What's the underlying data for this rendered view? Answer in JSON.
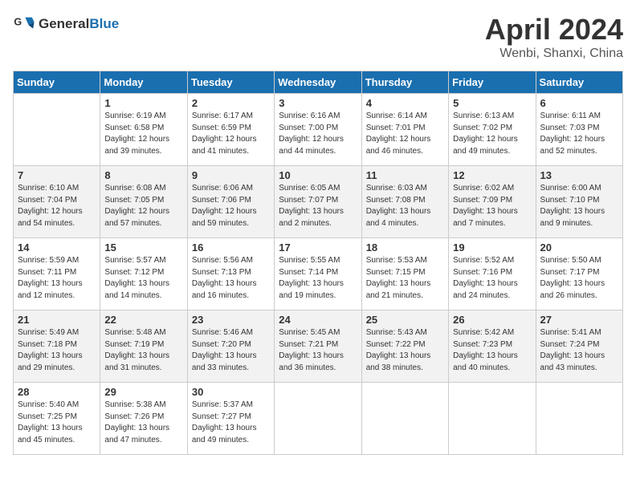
{
  "header": {
    "logo_general": "General",
    "logo_blue": "Blue",
    "month_year": "April 2024",
    "location": "Wenbi, Shanxi, China"
  },
  "days_of_week": [
    "Sunday",
    "Monday",
    "Tuesday",
    "Wednesday",
    "Thursday",
    "Friday",
    "Saturday"
  ],
  "weeks": [
    [
      {
        "day": "",
        "info": ""
      },
      {
        "day": "1",
        "info": "Sunrise: 6:19 AM\nSunset: 6:58 PM\nDaylight: 12 hours\nand 39 minutes."
      },
      {
        "day": "2",
        "info": "Sunrise: 6:17 AM\nSunset: 6:59 PM\nDaylight: 12 hours\nand 41 minutes."
      },
      {
        "day": "3",
        "info": "Sunrise: 6:16 AM\nSunset: 7:00 PM\nDaylight: 12 hours\nand 44 minutes."
      },
      {
        "day": "4",
        "info": "Sunrise: 6:14 AM\nSunset: 7:01 PM\nDaylight: 12 hours\nand 46 minutes."
      },
      {
        "day": "5",
        "info": "Sunrise: 6:13 AM\nSunset: 7:02 PM\nDaylight: 12 hours\nand 49 minutes."
      },
      {
        "day": "6",
        "info": "Sunrise: 6:11 AM\nSunset: 7:03 PM\nDaylight: 12 hours\nand 52 minutes."
      }
    ],
    [
      {
        "day": "7",
        "info": "Sunrise: 6:10 AM\nSunset: 7:04 PM\nDaylight: 12 hours\nand 54 minutes."
      },
      {
        "day": "8",
        "info": "Sunrise: 6:08 AM\nSunset: 7:05 PM\nDaylight: 12 hours\nand 57 minutes."
      },
      {
        "day": "9",
        "info": "Sunrise: 6:06 AM\nSunset: 7:06 PM\nDaylight: 12 hours\nand 59 minutes."
      },
      {
        "day": "10",
        "info": "Sunrise: 6:05 AM\nSunset: 7:07 PM\nDaylight: 13 hours\nand 2 minutes."
      },
      {
        "day": "11",
        "info": "Sunrise: 6:03 AM\nSunset: 7:08 PM\nDaylight: 13 hours\nand 4 minutes."
      },
      {
        "day": "12",
        "info": "Sunrise: 6:02 AM\nSunset: 7:09 PM\nDaylight: 13 hours\nand 7 minutes."
      },
      {
        "day": "13",
        "info": "Sunrise: 6:00 AM\nSunset: 7:10 PM\nDaylight: 13 hours\nand 9 minutes."
      }
    ],
    [
      {
        "day": "14",
        "info": "Sunrise: 5:59 AM\nSunset: 7:11 PM\nDaylight: 13 hours\nand 12 minutes."
      },
      {
        "day": "15",
        "info": "Sunrise: 5:57 AM\nSunset: 7:12 PM\nDaylight: 13 hours\nand 14 minutes."
      },
      {
        "day": "16",
        "info": "Sunrise: 5:56 AM\nSunset: 7:13 PM\nDaylight: 13 hours\nand 16 minutes."
      },
      {
        "day": "17",
        "info": "Sunrise: 5:55 AM\nSunset: 7:14 PM\nDaylight: 13 hours\nand 19 minutes."
      },
      {
        "day": "18",
        "info": "Sunrise: 5:53 AM\nSunset: 7:15 PM\nDaylight: 13 hours\nand 21 minutes."
      },
      {
        "day": "19",
        "info": "Sunrise: 5:52 AM\nSunset: 7:16 PM\nDaylight: 13 hours\nand 24 minutes."
      },
      {
        "day": "20",
        "info": "Sunrise: 5:50 AM\nSunset: 7:17 PM\nDaylight: 13 hours\nand 26 minutes."
      }
    ],
    [
      {
        "day": "21",
        "info": "Sunrise: 5:49 AM\nSunset: 7:18 PM\nDaylight: 13 hours\nand 29 minutes."
      },
      {
        "day": "22",
        "info": "Sunrise: 5:48 AM\nSunset: 7:19 PM\nDaylight: 13 hours\nand 31 minutes."
      },
      {
        "day": "23",
        "info": "Sunrise: 5:46 AM\nSunset: 7:20 PM\nDaylight: 13 hours\nand 33 minutes."
      },
      {
        "day": "24",
        "info": "Sunrise: 5:45 AM\nSunset: 7:21 PM\nDaylight: 13 hours\nand 36 minutes."
      },
      {
        "day": "25",
        "info": "Sunrise: 5:43 AM\nSunset: 7:22 PM\nDaylight: 13 hours\nand 38 minutes."
      },
      {
        "day": "26",
        "info": "Sunrise: 5:42 AM\nSunset: 7:23 PM\nDaylight: 13 hours\nand 40 minutes."
      },
      {
        "day": "27",
        "info": "Sunrise: 5:41 AM\nSunset: 7:24 PM\nDaylight: 13 hours\nand 43 minutes."
      }
    ],
    [
      {
        "day": "28",
        "info": "Sunrise: 5:40 AM\nSunset: 7:25 PM\nDaylight: 13 hours\nand 45 minutes."
      },
      {
        "day": "29",
        "info": "Sunrise: 5:38 AM\nSunset: 7:26 PM\nDaylight: 13 hours\nand 47 minutes."
      },
      {
        "day": "30",
        "info": "Sunrise: 5:37 AM\nSunset: 7:27 PM\nDaylight: 13 hours\nand 49 minutes."
      },
      {
        "day": "",
        "info": ""
      },
      {
        "day": "",
        "info": ""
      },
      {
        "day": "",
        "info": ""
      },
      {
        "day": "",
        "info": ""
      }
    ]
  ]
}
